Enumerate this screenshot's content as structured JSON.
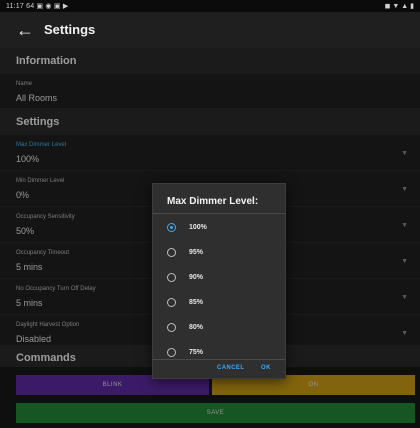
{
  "statusbar": {
    "left": "11:17 64 ▣ ◉ ▣ ▶",
    "right": "◼ ▼ ▲ ▮"
  },
  "appbar": {
    "title": "Settings"
  },
  "sections": {
    "information": "Information",
    "settings": "Settings",
    "commands": "Commands"
  },
  "info_row": {
    "label": "Name",
    "value": "All Rooms"
  },
  "settings_rows": [
    {
      "label": "Max Dimmer Level",
      "value": "100%"
    },
    {
      "label": "Min Dimmer Level",
      "value": "0%"
    },
    {
      "label": "Occupancy Sensitivity",
      "value": "50%"
    },
    {
      "label": "Occupancy Timeout",
      "value": "5 mins"
    },
    {
      "label": "No Occupancy Turn Off Delay",
      "value": "5 mins"
    },
    {
      "label": "Daylight Harvest Option",
      "value": "Disabled"
    }
  ],
  "commands": {
    "blink": "BLINK",
    "right": "ON",
    "save": "SAVE"
  },
  "dialog": {
    "title": "Max Dimmer Level:",
    "options": [
      "100%",
      "95%",
      "90%",
      "85%",
      "80%",
      "75%"
    ],
    "selected_index": 0,
    "cancel": "CANCEL",
    "ok": "OK"
  },
  "colors": {
    "accent": "#3fa9f5",
    "blink": "#5b2a9e",
    "commandRight": "#c79a14",
    "save": "#218436"
  }
}
